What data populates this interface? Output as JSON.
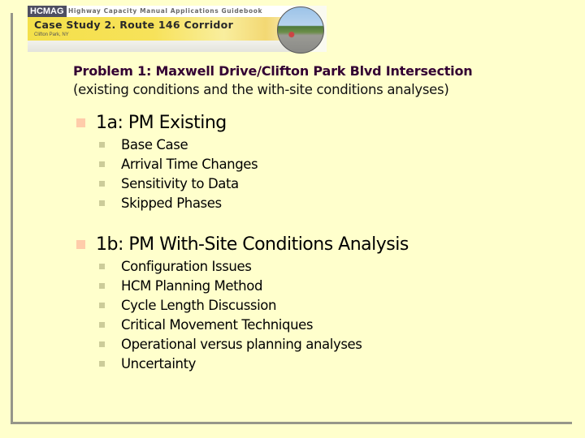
{
  "banner": {
    "tag": "HCMAG",
    "guidebook_title": "Highway Capacity Manual Applications Guidebook",
    "case_study_title": "Case Study 2. Route 146 Corridor",
    "location": "Clifton Park, NY",
    "photo": "road-photo"
  },
  "problem": {
    "title": "Problem 1: Maxwell Drive/Clifton Park Blvd Intersection",
    "subtitle": "(existing conditions and the with-site conditions analyses)"
  },
  "sections": [
    {
      "label": "1a: PM Existing",
      "items": [
        "Base Case",
        "Arrival Time Changes",
        "Sensitivity to Data",
        "Skipped Phases"
      ]
    },
    {
      "label": "1b: PM With-Site Conditions Analysis",
      "items": [
        "Configuration Issues",
        "HCM Planning Method",
        "Cycle Length Discussion",
        "Critical Movement Techniques",
        "Operational versus planning analyses",
        "Uncertainty"
      ]
    }
  ],
  "colors": {
    "background": "#FFFFCC",
    "title": "#330033",
    "bullet_level1": "#FFCCAA",
    "bullet_level2": "#CCCC99",
    "frame": "#96968A"
  }
}
